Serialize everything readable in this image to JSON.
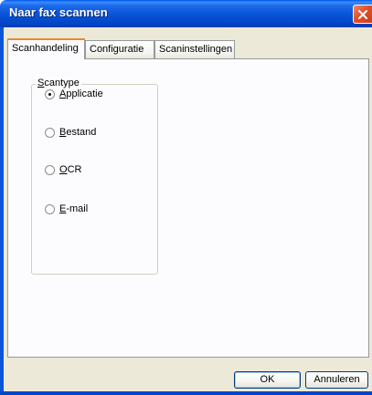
{
  "window": {
    "title": "Naar fax scannen"
  },
  "tabs": [
    {
      "label": "Scanhandeling",
      "active": true
    },
    {
      "label": "Configuratie",
      "active": false
    },
    {
      "label": "Scaninstellingen",
      "active": false
    }
  ],
  "scantype": {
    "legend": "Scantype",
    "legend_underline": "S",
    "legend_rest": "cantype",
    "options": [
      {
        "label": "Applicatie",
        "underline": "A",
        "rest": "pplicatie",
        "selected": true
      },
      {
        "label": "Bestand",
        "underline": "B",
        "rest": "estand",
        "selected": false
      },
      {
        "label": "OCR",
        "underline": "O",
        "rest": "CR",
        "selected": false
      },
      {
        "label": "E-mail",
        "underline": "E",
        "rest": "-mail",
        "selected": false
      }
    ]
  },
  "buttons": {
    "ok": "OK",
    "cancel": "Annuleren"
  },
  "colors": {
    "title_bar": "#0a55d8",
    "close_button": "#e0502a",
    "dialog_background": "#ece9d8",
    "active_tab_highlight": "#e68b2c"
  },
  "icons": {
    "close": "close-icon"
  }
}
